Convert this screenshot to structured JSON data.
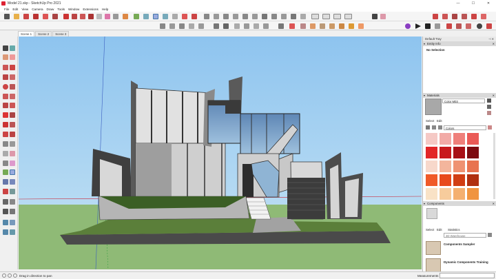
{
  "window": {
    "title": "Model 21.skp - SketchUp Pro 2021",
    "controls": [
      "—",
      "☐",
      "✕"
    ]
  },
  "menu": [
    "File",
    "Edit",
    "View",
    "Camera",
    "Draw",
    "Tools",
    "Window",
    "Extensions",
    "Help"
  ],
  "scene_tabs": [
    "Scene 1",
    "Scene 2",
    "Scene 3"
  ],
  "tray": {
    "title": "Default Tray",
    "pin": "⊣ ✕",
    "entity_info": {
      "header": "Entity Info",
      "selection": "No Selection"
    },
    "materials": {
      "header": "Materials",
      "material_name": "Color M03",
      "tab_select": "Select",
      "tab_edit": "Edit",
      "library": "Colors",
      "swatches": [
        "#f5c9c5",
        "#f2aaa6",
        "#ef7f7a",
        "#ea5a56",
        "#e22628",
        "#c8191c",
        "#a81016",
        "#7d0b10",
        "#f7d8cb",
        "#f3b59c",
        "#ef9272",
        "#e87350",
        "#f05a28",
        "#e84a1c",
        "#d13e14",
        "#b03010",
        "#f9e2c6",
        "#f7cc9c",
        "#f4b070",
        "#f09440"
      ]
    },
    "components": {
      "header": "Components",
      "tab_select": "Select",
      "tab_edit": "Edit",
      "tab_statistics": "Statistics",
      "search_placeholder": "3D Warehouse",
      "items": [
        {
          "title": "Components Sampler"
        },
        {
          "title": "Dynamic Components Training"
        }
      ]
    }
  },
  "status": {
    "hint": "Drag in direction to pan",
    "measurements_label": "Measurements"
  }
}
